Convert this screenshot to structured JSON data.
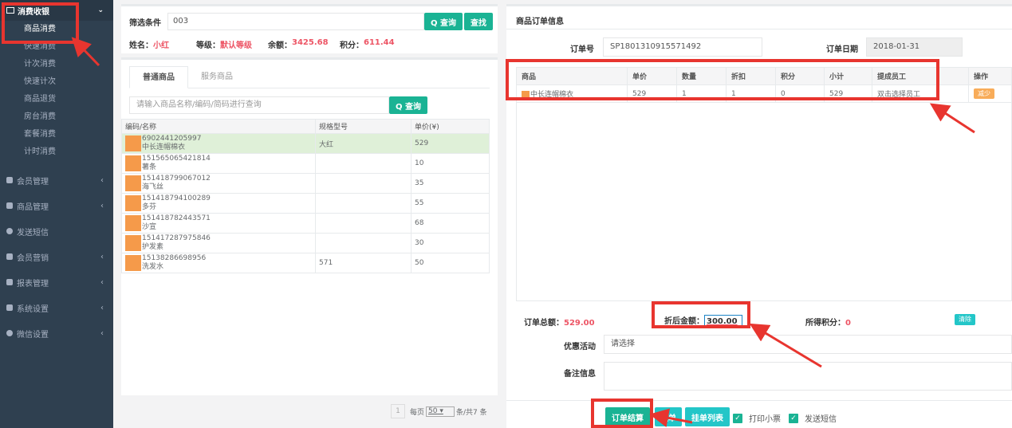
{
  "sidebar": {
    "header": "消费收银",
    "sub_items": [
      "商品消费",
      "快速消费",
      "计次消费",
      "快速计次",
      "商品退货",
      "房台消费",
      "套餐消费",
      "计时消费"
    ],
    "items": [
      {
        "label": "会员管理",
        "icon": "users-icon"
      },
      {
        "label": "商品管理",
        "icon": "list-icon"
      },
      {
        "label": "发送短信",
        "icon": "message-icon"
      },
      {
        "label": "会员营销",
        "icon": "briefcase-icon"
      },
      {
        "label": "报表管理",
        "icon": "chart-icon"
      },
      {
        "label": "系统设置",
        "icon": "cogs-icon"
      },
      {
        "label": "微信设置",
        "icon": "wechat-icon"
      }
    ]
  },
  "filter": {
    "label": "筛选条件",
    "value": "003",
    "query_button": "Q 查询",
    "find_button": "查找"
  },
  "member": {
    "name_label": "姓名：",
    "name": "小红",
    "level_label": "等级：",
    "level": "默认等级",
    "balance_label": "余额：",
    "balance": "3425.68",
    "points_label": "积分：",
    "points": "611.44"
  },
  "goods": {
    "tabs": [
      "普通商品",
      "服务商品"
    ],
    "search_placeholder": "请输入商品名称/编码/简码进行查询",
    "search_button": "Q 查询",
    "columns": [
      "编码/名称",
      "规格型号",
      "单价(¥)"
    ],
    "rows": [
      {
        "code": "6902441205997",
        "name": "中长连帽棉衣",
        "spec": "大红",
        "price": "529"
      },
      {
        "code": "151565065421814",
        "name": "薯条",
        "spec": "",
        "price": "10"
      },
      {
        "code": "151418799067012",
        "name": "海飞丝",
        "spec": "",
        "price": "35"
      },
      {
        "code": "151418794100289",
        "name": "多芬",
        "spec": "",
        "price": "55"
      },
      {
        "code": "151418782443571",
        "name": "沙宣",
        "spec": "",
        "price": "68"
      },
      {
        "code": "151417287975846",
        "name": "护发素",
        "spec": "",
        "price": "30"
      },
      {
        "code": "15138286698956",
        "name": "洗发水",
        "spec": "571",
        "price": "50"
      }
    ],
    "pager": {
      "page": "1",
      "per_page_label": "每页",
      "per_page": "50",
      "suffix": "条/共7 条"
    }
  },
  "order": {
    "title": "商品订单信息",
    "order_no_label": "订单号",
    "order_no": "SP1801310915571492",
    "order_date_label": "订单日期",
    "order_date": "2018-01-31",
    "columns": [
      "商品",
      "单价",
      "数量",
      "折扣",
      "积分",
      "小计",
      "提成员工",
      "操作"
    ],
    "items": [
      {
        "name": "中长连帽棉衣",
        "price": "529",
        "qty": "1",
        "discount": "1",
        "points": "0",
        "subtotal": "529",
        "staff": "双击选择员工",
        "action": "减少"
      }
    ],
    "total_label": "订单总额：",
    "total": "529.00",
    "discount_label": "折后金额：",
    "discount_amount": "300.00",
    "earn_label": "所得积分：",
    "earn_points": "0",
    "clear_button": "清除",
    "promo_label": "优惠活动",
    "promo_value": "请选择",
    "remark_label": "备注信息",
    "settle_button": "订单结算",
    "hang_button": "挂单",
    "hang_list_button": "挂单列表",
    "print_label": "打印小票",
    "sms_label": "发送短信"
  },
  "colors": {
    "sidebar_bg": "#2f4050",
    "accent": "#1ab394",
    "annotation": "#e8352f",
    "warning": "#ed5565"
  }
}
